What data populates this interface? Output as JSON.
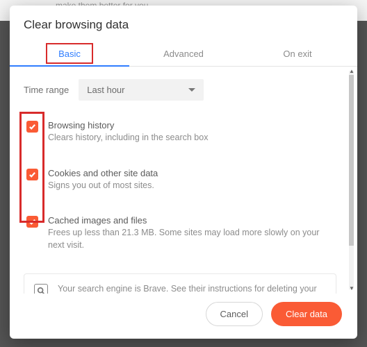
{
  "background_text": "make them better for you.",
  "modal": {
    "title": "Clear browsing data",
    "tabs": {
      "basic": "Basic",
      "advanced": "Advanced",
      "on_exit": "On exit",
      "active": "basic"
    },
    "time_range": {
      "label": "Time range",
      "selected": "Last hour"
    },
    "options": [
      {
        "title": "Browsing history",
        "desc": "Clears history, including in the search box",
        "checked": true
      },
      {
        "title": "Cookies and other site data",
        "desc": "Signs you out of most sites.",
        "checked": true
      },
      {
        "title": "Cached images and files",
        "desc": "Frees up less than 21.3 MB. Some sites may load more slowly on your next visit.",
        "checked": true
      }
    ],
    "info_note": "Your search engine is Brave. See their instructions for deleting your search history, if applicable.",
    "buttons": {
      "cancel": "Cancel",
      "clear": "Clear data"
    }
  },
  "colors": {
    "accent": "#fa5b35",
    "tab_active": "#2f7dff",
    "highlight": "#d82b2b"
  }
}
